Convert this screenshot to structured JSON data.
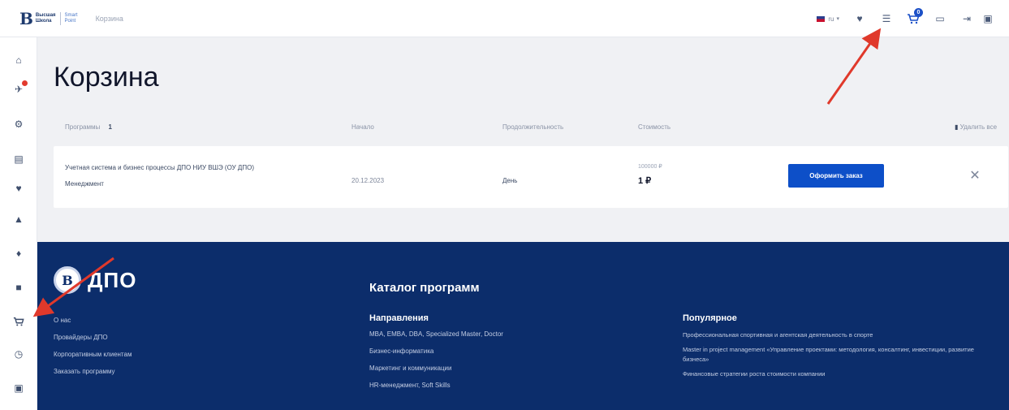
{
  "header": {
    "logo_mark": "B",
    "logo_line1": "Высшая",
    "logo_line2": "Школа",
    "logo_sub1": "Smart",
    "logo_sub2": "Point",
    "breadcrumb": "Корзина",
    "language": "ru",
    "cart_count": "0"
  },
  "main": {
    "title": "Корзина",
    "table_headers": {
      "program": "Программы",
      "program_count": "1",
      "start": "Начало",
      "duration": "Продолжительность",
      "price": "Стоимость",
      "clear": "Удалить все"
    },
    "item": {
      "name": "Учетная система и бизнес процессы ДПО НИУ ВШЭ (ОУ ДПО)",
      "category": "Менеджмент",
      "date": "20.12.2023",
      "duration": "День",
      "old_price": "100000 ₽",
      "price": "1 ₽",
      "order_button": "Оформить заказ"
    }
  },
  "footer": {
    "brand": "ДПО",
    "seal_letter": "В",
    "links": [
      "О нас",
      "Провайдеры ДПО",
      "Корпоративным клиентам",
      "Заказать программу"
    ],
    "catalog_title": "Каталог программ",
    "directions_title": "Направления",
    "directions": [
      "MBA, EMBA, DBA, Specialized Master, Doctor",
      "Бизнес-информатика",
      "Маркетинг и коммуникации",
      "HR-менеджмент, Soft Skills"
    ],
    "popular_title": "Популярное",
    "popular": [
      "Профессиональная спортивная и агентская деятельность в спорте",
      "Master in project management «Управление проектами: методология, консалтинг, инвестиции, развитие бизнеса»",
      "Финансовые стратегии роста стоимости компании"
    ]
  },
  "colors": {
    "footer_bg": "#0c2d6b",
    "accent_button": "#0d4fc8",
    "arrow": "#e0392b"
  }
}
